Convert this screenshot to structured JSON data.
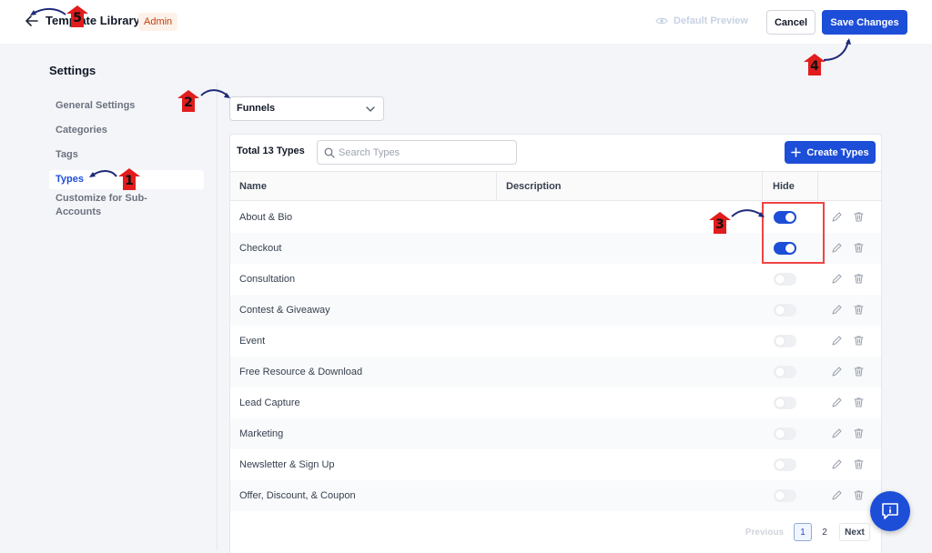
{
  "header": {
    "title": "Template Library",
    "badge": "Admin",
    "preview_label": "Default Preview",
    "cancel_label": "Cancel",
    "save_label": "Save Changes"
  },
  "sidebar": {
    "title": "Settings",
    "items": [
      {
        "label": "General Settings"
      },
      {
        "label": "Categories"
      },
      {
        "label": "Tags"
      },
      {
        "label": "Types"
      },
      {
        "label": "Customize for Sub-Accounts"
      }
    ]
  },
  "filter": {
    "selected": "Funnels"
  },
  "table": {
    "total_label": "Total 13 Types",
    "search_placeholder": "Search Types",
    "create_label": "Create Types",
    "columns": {
      "name": "Name",
      "description": "Description",
      "hide": "Hide"
    },
    "rows": [
      {
        "name": "About & Bio",
        "hidden": true
      },
      {
        "name": "Checkout",
        "hidden": true
      },
      {
        "name": "Consultation",
        "hidden": false
      },
      {
        "name": "Contest & Giveaway",
        "hidden": false
      },
      {
        "name": "Event",
        "hidden": false
      },
      {
        "name": "Free Resource & Download",
        "hidden": false
      },
      {
        "name": "Lead Capture",
        "hidden": false
      },
      {
        "name": "Marketing",
        "hidden": false
      },
      {
        "name": "Newsletter & Sign Up",
        "hidden": false
      },
      {
        "name": "Offer, Discount, & Coupon",
        "hidden": false
      }
    ]
  },
  "pagination": {
    "previous_label": "Previous",
    "pages": [
      "1",
      "2"
    ],
    "next_label": "Next"
  },
  "annotations": {
    "markers": [
      "1",
      "2",
      "3",
      "4",
      "5"
    ]
  },
  "colors": {
    "primary": "#1d4ed8",
    "highlight": "#ef4444",
    "marker": "#e11d1d"
  }
}
